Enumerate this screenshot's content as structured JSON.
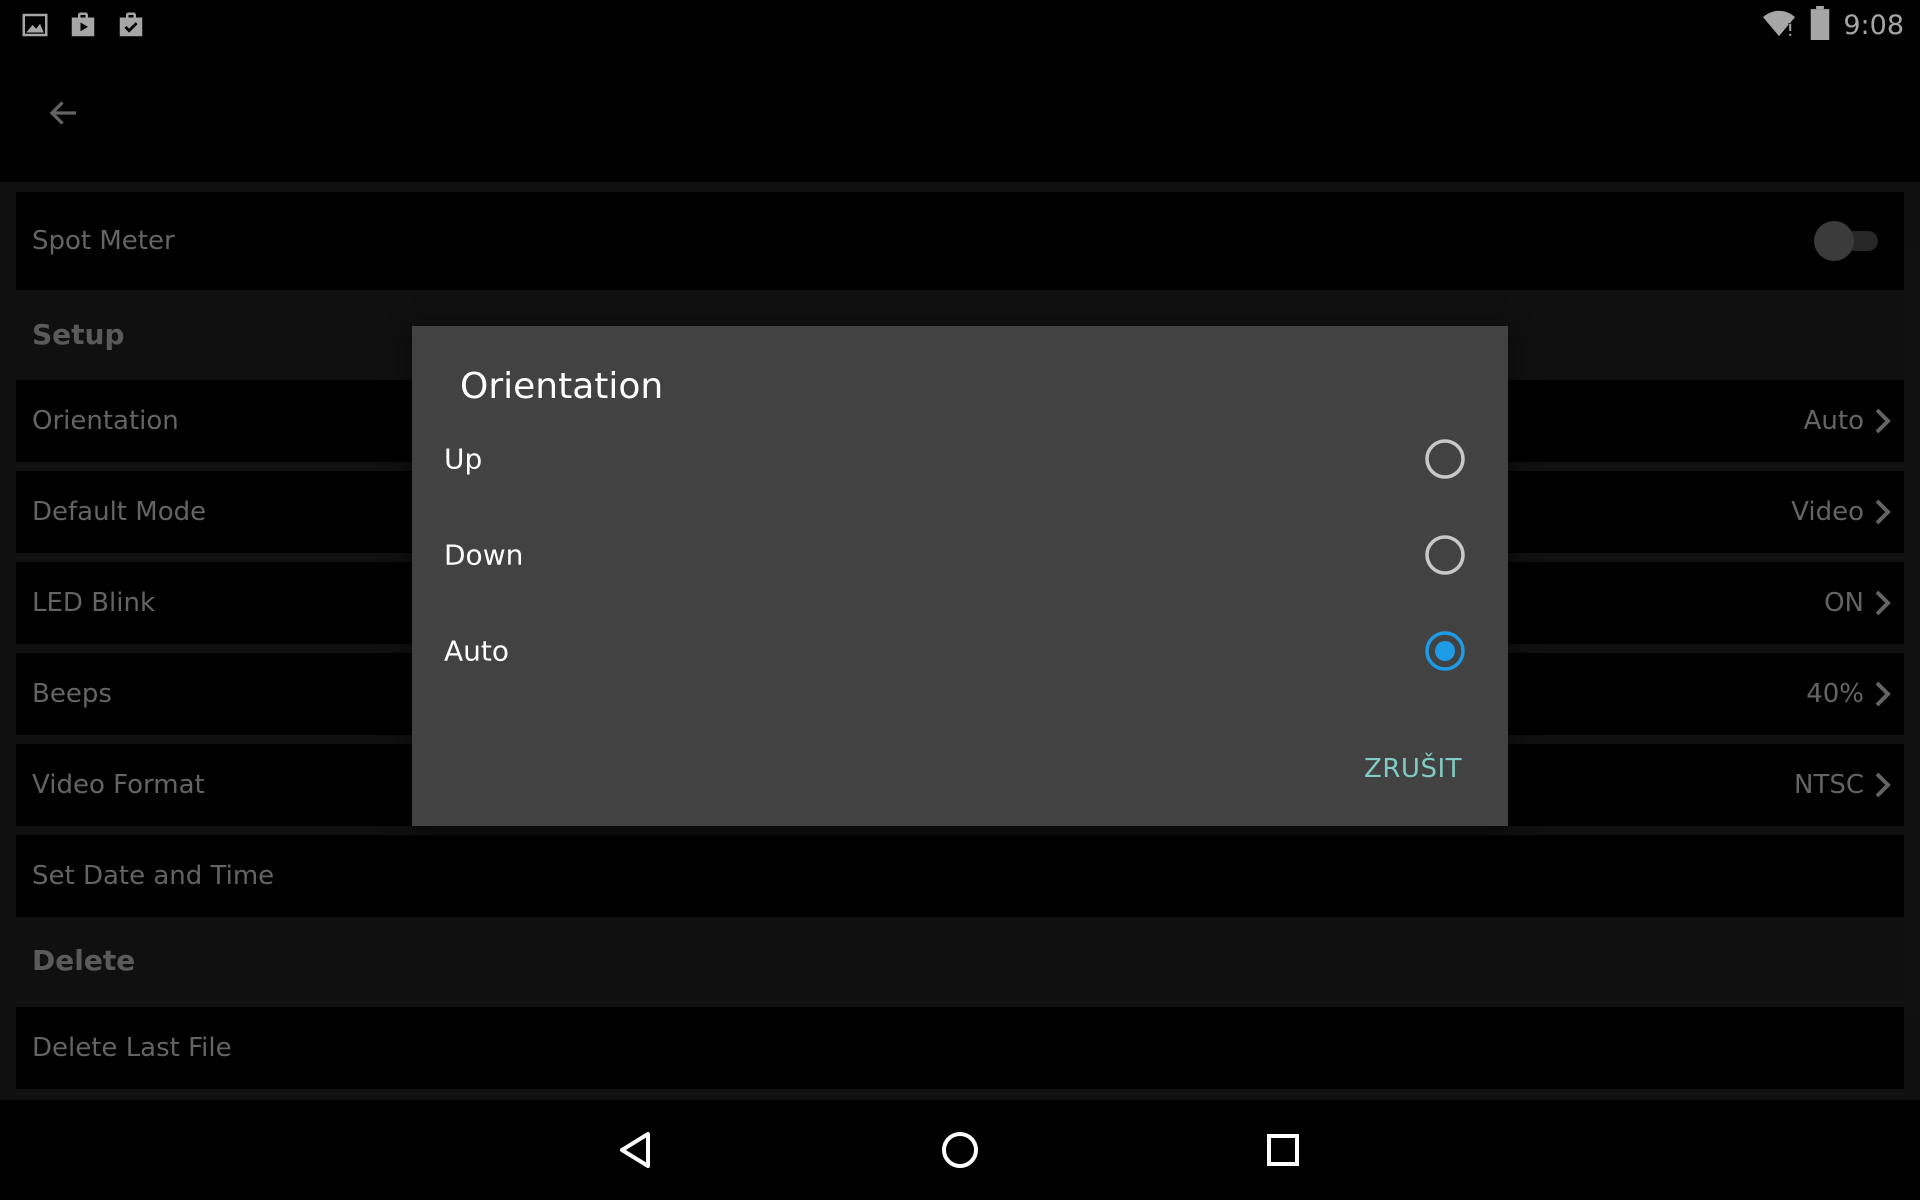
{
  "status_bar": {
    "time": "9:08",
    "left_icons": [
      "image-icon",
      "play-store-bag-icon",
      "clipboard-check-icon"
    ],
    "right_icons": [
      "wifi-alert-icon",
      "battery-icon"
    ]
  },
  "app_bar": {
    "back_icon": "arrow-left-icon"
  },
  "settings": {
    "spot_meter": {
      "label": "Spot Meter",
      "enabled": false
    },
    "setup_header": "Setup",
    "orientation": {
      "label": "Orientation",
      "value": "Auto"
    },
    "default_mode": {
      "label": "Default Mode",
      "value": "Video"
    },
    "led_blink": {
      "label": "LED Blink",
      "value": "ON"
    },
    "beeps": {
      "label": "Beeps",
      "value": "40%"
    },
    "video_format": {
      "label": "Video Format",
      "value": "NTSC"
    },
    "set_date_time": {
      "label": "Set Date and Time"
    },
    "delete_header": "Delete",
    "delete_last_file": {
      "label": "Delete Last File"
    }
  },
  "dialog": {
    "title": "Orientation",
    "options": [
      {
        "label": "Up",
        "selected": false
      },
      {
        "label": "Down",
        "selected": false
      },
      {
        "label": "Auto",
        "selected": true
      }
    ],
    "cancel_label": "ZRUŠIT"
  },
  "colors": {
    "accent": "#1e9be6",
    "cancel_text": "#80cbc4",
    "dialog_bg": "#424242",
    "row_text": "#9a9a9a"
  },
  "nav_bar": {
    "icons": [
      "back-triangle-icon",
      "home-circle-icon",
      "recents-square-icon"
    ]
  }
}
